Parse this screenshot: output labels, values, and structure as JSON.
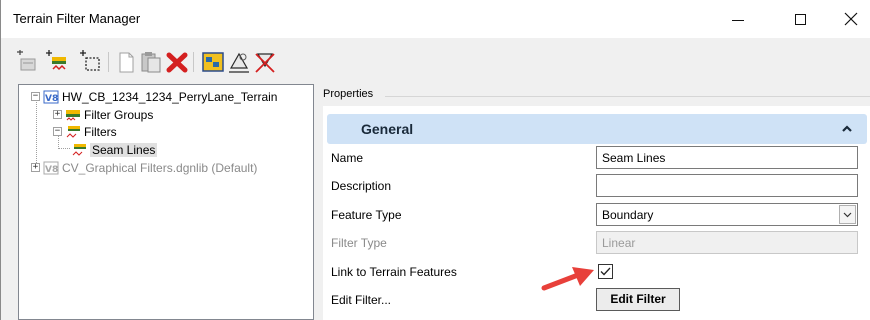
{
  "window": {
    "title": "Terrain Filter Manager",
    "controls": {
      "minimize": "–",
      "maximize": "☐",
      "close": "✕"
    }
  },
  "toolbar": {
    "buttons": [
      "new-filter-group-icon",
      "new-filter-icon",
      "new-graphical-filter-icon",
      "copy-icon",
      "paste-icon",
      "delete-icon",
      "test-filter-icon",
      "select-elements-icon",
      "clear-selection-icon"
    ]
  },
  "tree": {
    "nodes": [
      {
        "label": "HW_CB_1234_1234_PerryLane_Terrain",
        "expander": "−",
        "dim": false
      },
      {
        "label": "Filter Groups",
        "expander": "+",
        "dim": false
      },
      {
        "label": "Filters",
        "expander": "−",
        "dim": false
      },
      {
        "label": "Seam Lines",
        "expander": "",
        "dim": false,
        "selected": true
      },
      {
        "label": "CV_Graphical Filters.dgnlib (Default)",
        "expander": "+",
        "dim": true
      }
    ]
  },
  "properties": {
    "caption": "Properties",
    "group": {
      "title": "General",
      "collapse_icon": "chevron-up-icon"
    },
    "rows": [
      {
        "label": "Name",
        "value": "Seam Lines",
        "type": "text"
      },
      {
        "label": "Description",
        "value": "",
        "type": "text"
      },
      {
        "label": "Feature Type",
        "value": "Boundary",
        "type": "dropdown"
      },
      {
        "label": "Filter Type",
        "value": "Linear",
        "type": "disabled"
      },
      {
        "label": "Link to Terrain Features",
        "checked": true,
        "type": "checkbox"
      },
      {
        "label": "Edit Filter...",
        "button": "Edit Filter",
        "type": "button"
      }
    ]
  },
  "colors": {
    "group_header": "#cfe2f6",
    "arrow": "#e8403a",
    "delete_red": "#d42020"
  }
}
